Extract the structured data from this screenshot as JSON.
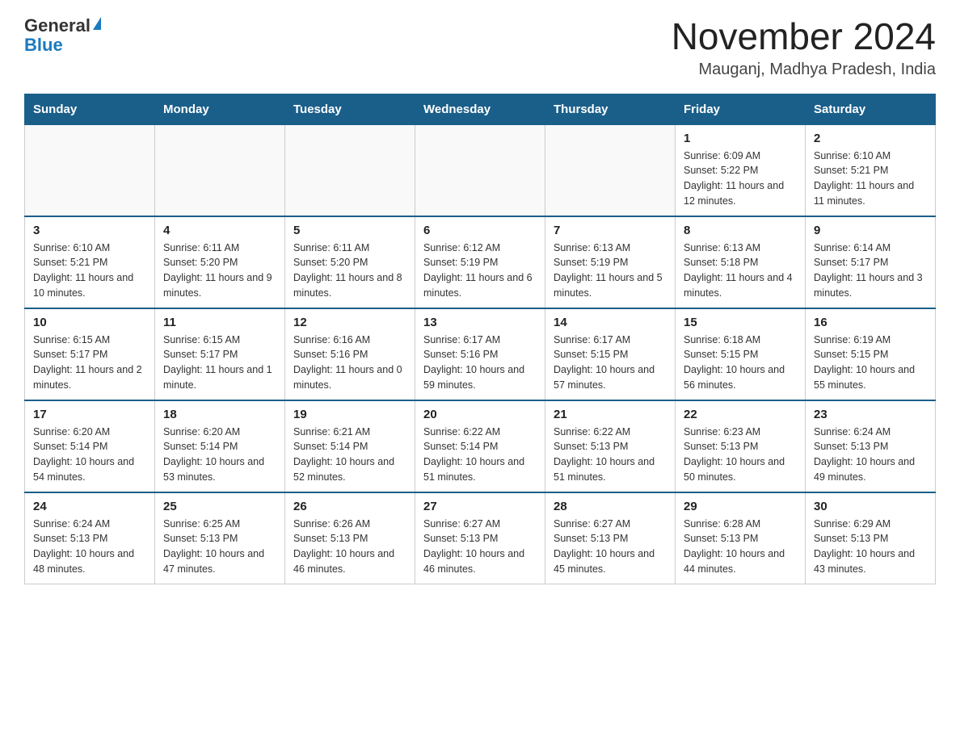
{
  "logo": {
    "general": "General",
    "blue": "Blue"
  },
  "title": "November 2024",
  "subtitle": "Mauganj, Madhya Pradesh, India",
  "weekdays": [
    "Sunday",
    "Monday",
    "Tuesday",
    "Wednesday",
    "Thursday",
    "Friday",
    "Saturday"
  ],
  "weeks": [
    [
      {
        "day": "",
        "info": ""
      },
      {
        "day": "",
        "info": ""
      },
      {
        "day": "",
        "info": ""
      },
      {
        "day": "",
        "info": ""
      },
      {
        "day": "",
        "info": ""
      },
      {
        "day": "1",
        "info": "Sunrise: 6:09 AM\nSunset: 5:22 PM\nDaylight: 11 hours and 12 minutes."
      },
      {
        "day": "2",
        "info": "Sunrise: 6:10 AM\nSunset: 5:21 PM\nDaylight: 11 hours and 11 minutes."
      }
    ],
    [
      {
        "day": "3",
        "info": "Sunrise: 6:10 AM\nSunset: 5:21 PM\nDaylight: 11 hours and 10 minutes."
      },
      {
        "day": "4",
        "info": "Sunrise: 6:11 AM\nSunset: 5:20 PM\nDaylight: 11 hours and 9 minutes."
      },
      {
        "day": "5",
        "info": "Sunrise: 6:11 AM\nSunset: 5:20 PM\nDaylight: 11 hours and 8 minutes."
      },
      {
        "day": "6",
        "info": "Sunrise: 6:12 AM\nSunset: 5:19 PM\nDaylight: 11 hours and 6 minutes."
      },
      {
        "day": "7",
        "info": "Sunrise: 6:13 AM\nSunset: 5:19 PM\nDaylight: 11 hours and 5 minutes."
      },
      {
        "day": "8",
        "info": "Sunrise: 6:13 AM\nSunset: 5:18 PM\nDaylight: 11 hours and 4 minutes."
      },
      {
        "day": "9",
        "info": "Sunrise: 6:14 AM\nSunset: 5:17 PM\nDaylight: 11 hours and 3 minutes."
      }
    ],
    [
      {
        "day": "10",
        "info": "Sunrise: 6:15 AM\nSunset: 5:17 PM\nDaylight: 11 hours and 2 minutes."
      },
      {
        "day": "11",
        "info": "Sunrise: 6:15 AM\nSunset: 5:17 PM\nDaylight: 11 hours and 1 minute."
      },
      {
        "day": "12",
        "info": "Sunrise: 6:16 AM\nSunset: 5:16 PM\nDaylight: 11 hours and 0 minutes."
      },
      {
        "day": "13",
        "info": "Sunrise: 6:17 AM\nSunset: 5:16 PM\nDaylight: 10 hours and 59 minutes."
      },
      {
        "day": "14",
        "info": "Sunrise: 6:17 AM\nSunset: 5:15 PM\nDaylight: 10 hours and 57 minutes."
      },
      {
        "day": "15",
        "info": "Sunrise: 6:18 AM\nSunset: 5:15 PM\nDaylight: 10 hours and 56 minutes."
      },
      {
        "day": "16",
        "info": "Sunrise: 6:19 AM\nSunset: 5:15 PM\nDaylight: 10 hours and 55 minutes."
      }
    ],
    [
      {
        "day": "17",
        "info": "Sunrise: 6:20 AM\nSunset: 5:14 PM\nDaylight: 10 hours and 54 minutes."
      },
      {
        "day": "18",
        "info": "Sunrise: 6:20 AM\nSunset: 5:14 PM\nDaylight: 10 hours and 53 minutes."
      },
      {
        "day": "19",
        "info": "Sunrise: 6:21 AM\nSunset: 5:14 PM\nDaylight: 10 hours and 52 minutes."
      },
      {
        "day": "20",
        "info": "Sunrise: 6:22 AM\nSunset: 5:14 PM\nDaylight: 10 hours and 51 minutes."
      },
      {
        "day": "21",
        "info": "Sunrise: 6:22 AM\nSunset: 5:13 PM\nDaylight: 10 hours and 51 minutes."
      },
      {
        "day": "22",
        "info": "Sunrise: 6:23 AM\nSunset: 5:13 PM\nDaylight: 10 hours and 50 minutes."
      },
      {
        "day": "23",
        "info": "Sunrise: 6:24 AM\nSunset: 5:13 PM\nDaylight: 10 hours and 49 minutes."
      }
    ],
    [
      {
        "day": "24",
        "info": "Sunrise: 6:24 AM\nSunset: 5:13 PM\nDaylight: 10 hours and 48 minutes."
      },
      {
        "day": "25",
        "info": "Sunrise: 6:25 AM\nSunset: 5:13 PM\nDaylight: 10 hours and 47 minutes."
      },
      {
        "day": "26",
        "info": "Sunrise: 6:26 AM\nSunset: 5:13 PM\nDaylight: 10 hours and 46 minutes."
      },
      {
        "day": "27",
        "info": "Sunrise: 6:27 AM\nSunset: 5:13 PM\nDaylight: 10 hours and 46 minutes."
      },
      {
        "day": "28",
        "info": "Sunrise: 6:27 AM\nSunset: 5:13 PM\nDaylight: 10 hours and 45 minutes."
      },
      {
        "day": "29",
        "info": "Sunrise: 6:28 AM\nSunset: 5:13 PM\nDaylight: 10 hours and 44 minutes."
      },
      {
        "day": "30",
        "info": "Sunrise: 6:29 AM\nSunset: 5:13 PM\nDaylight: 10 hours and 43 minutes."
      }
    ]
  ]
}
